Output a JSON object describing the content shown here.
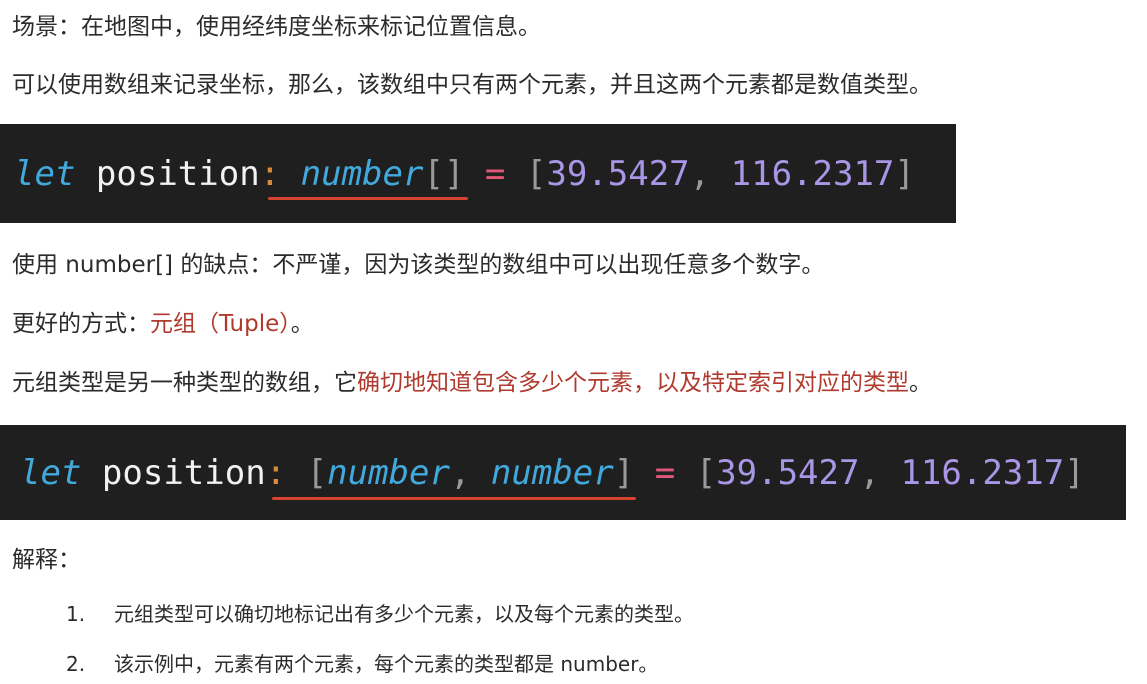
{
  "para1": "场景：在地图中，使用经纬度坐标来标记位置信息。",
  "para2": "可以使用数组来记录坐标，那么，该数组中只有两个元素，并且这两个元素都是数值类型。",
  "code1": {
    "kw": "let",
    "ident": "position",
    "colon": ":",
    "type": "number",
    "brackets": "[]",
    "eq": "=",
    "lbr": "[",
    "v1": "39.5427",
    "comma": ",",
    "v2": "116.2317",
    "rbr": "]"
  },
  "para3": "使用 number[] 的缺点：不严谨，因为该类型的数组中可以出现任意多个数字。",
  "para4": {
    "pre": "更好的方式：",
    "hl": "元组（Tuple）",
    "post": "。"
  },
  "para5": {
    "pre": "元组类型是另一种类型的数组，它",
    "hl": "确切地知道包含多少个元素，以及特定索引对应的类型",
    "post": "。"
  },
  "code2": {
    "kw": "let",
    "ident": "position",
    "colon": ":",
    "lbr": "[",
    "t1": "number",
    "comma": ",",
    "t2": "number",
    "rbr": "]",
    "eq": "=",
    "vlbr": "[",
    "v1": "39.5427",
    "vcomma": ",",
    "v2": "116.2317",
    "vrbr": "]"
  },
  "explain_title": "解释：",
  "list": [
    {
      "idx": "1.",
      "text": "元组类型可以确切地标记出有多少个元素，以及每个元素的类型。"
    },
    {
      "idx": "2.",
      "text": "该示例中，元素有两个元素，每个元素的类型都是 number。"
    }
  ],
  "colors": {
    "code_bg": "#1f1f1f",
    "highlight": "#b03a2e",
    "underline": "#d6432e"
  }
}
